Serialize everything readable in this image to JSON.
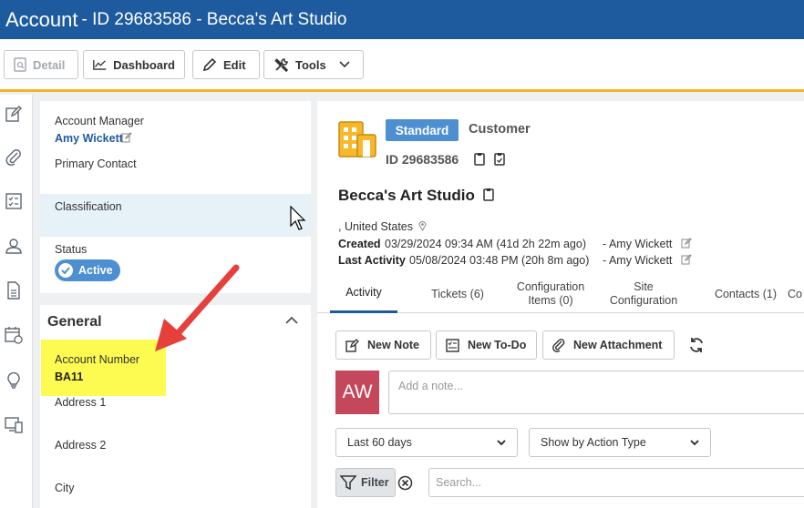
{
  "title": {
    "main": "Account",
    "sub": "- ID 29683586 - Becca's Art Studio"
  },
  "toolbar": {
    "detail": "Detail",
    "dashboard": "Dashboard",
    "edit": "Edit",
    "tools": "Tools"
  },
  "rail": {
    "icons": [
      "edit-note-icon",
      "paperclip-icon",
      "checklist-icon",
      "contact-icon",
      "document-icon",
      "calendar-icon",
      "lightbulb-icon",
      "devices-icon"
    ]
  },
  "left_panel": {
    "account_manager_label": "Account Manager",
    "account_manager_value": "Amy Wickett",
    "primary_contact_label": "Primary Contact",
    "classification_label": "Classification",
    "status_label": "Status",
    "status_value": "Active"
  },
  "general": {
    "title": "General",
    "account_number_label": "Account Number",
    "account_number_value": "BA11",
    "address1_label": "Address 1",
    "address2_label": "Address 2",
    "city_label": "City"
  },
  "header": {
    "badge": "Standard",
    "type": "Customer",
    "id": "ID 29683586",
    "name": "Becca's Art Studio",
    "location": ", United States",
    "created_label": "Created",
    "created_value": "03/29/2024 09:34 AM (41d 2h 22m ago)",
    "created_by": "-  Amy Wickett",
    "last_activity_label": "Last Activity",
    "last_activity_value": "05/08/2024 03:48 PM (20h 8m ago)",
    "last_activity_by": "-  Amy Wickett"
  },
  "tabs": [
    {
      "line1": "Activity",
      "line2": ""
    },
    {
      "line1": "Tickets (6)",
      "line2": ""
    },
    {
      "line1": "Configuration",
      "line2": "Items (0)"
    },
    {
      "line1": "Site",
      "line2": "Configuration"
    },
    {
      "line1": "Contacts (1)",
      "line2": ""
    },
    {
      "line1": "Co",
      "line2": ""
    }
  ],
  "actions": {
    "new_note": "New Note",
    "new_todo": "New To-Do",
    "new_attachment": "New Attachment"
  },
  "note": {
    "avatar": "AW",
    "placeholder": "Add a note..."
  },
  "filters": {
    "range": "Last 60 days",
    "group": "Show by Action Type",
    "filter_label": "Filter",
    "search_placeholder": "Search..."
  },
  "colors": {
    "title_bar": "#1d5b9e",
    "accent": "#f2b624",
    "badge": "#4d8fd0",
    "avatar": "#c4475c",
    "highlight": "#fdfa52",
    "arrow": "#e5403c"
  }
}
